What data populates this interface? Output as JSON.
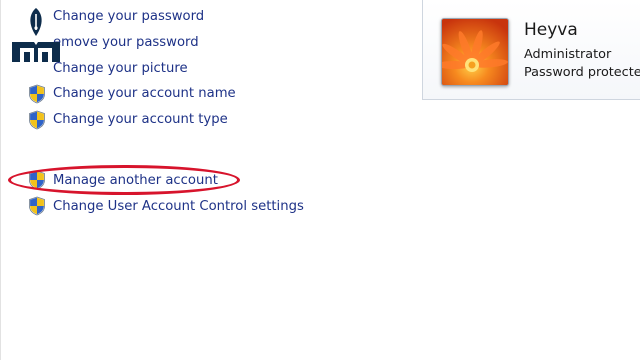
{
  "tasks": {
    "change_password": "Change your password",
    "remove_password": "emove your password",
    "change_picture": "Change your picture",
    "change_account_name": "Change your account name",
    "change_account_type": "Change your account type",
    "manage_another_account": "Manage another account",
    "change_uac_settings": "Change User Account Control settings"
  },
  "account": {
    "name": "Heyva",
    "role": "Administrator",
    "status": "Password protected"
  },
  "icons": {
    "shield": "uac-shield-icon",
    "avatar": "flower-avatar",
    "logo": "pen-book-logo"
  },
  "colors": {
    "link": "#1e3287",
    "highlight": "#d7142c",
    "logo": "#0d2c4b"
  }
}
